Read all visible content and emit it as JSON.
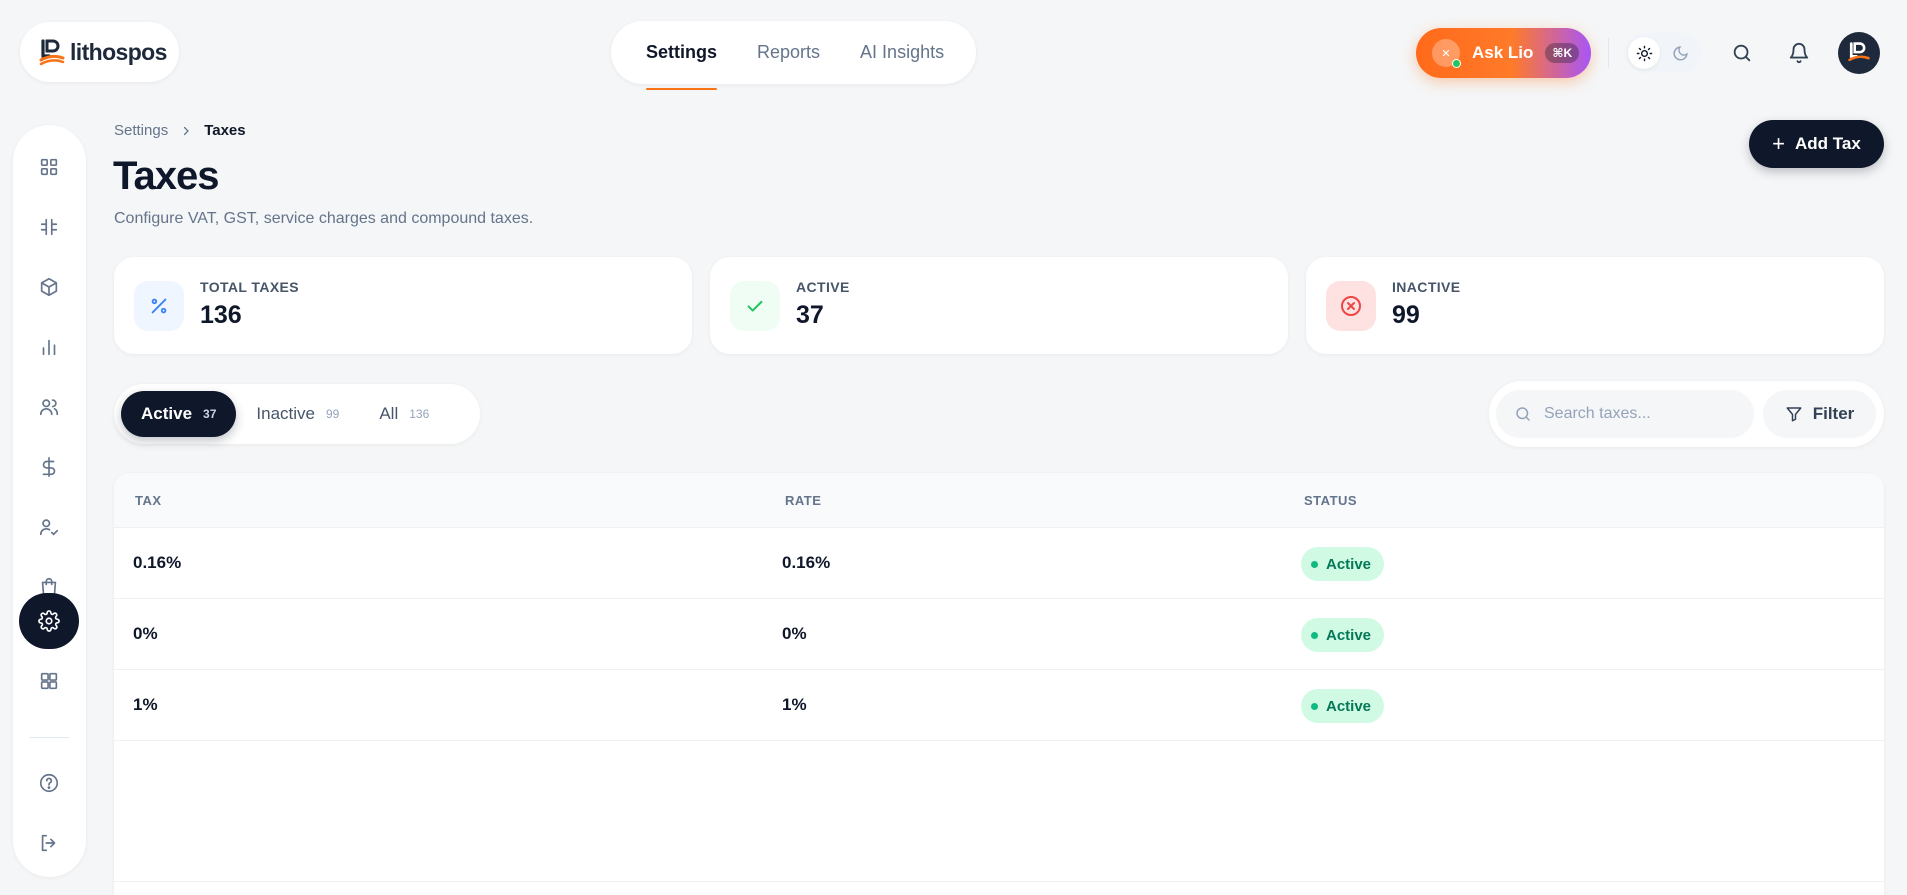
{
  "brand": {
    "name": "lithospos"
  },
  "topnav": {
    "tabs": [
      "Settings",
      "Reports",
      "AI Insights"
    ],
    "active": "Settings"
  },
  "assistant": {
    "label": "Ask Lio",
    "shortcut": "⌘K",
    "avatar": "✕"
  },
  "breadcrumb": {
    "parent": "Settings",
    "current": "Taxes"
  },
  "page": {
    "title": "Taxes",
    "subtitle": "Configure VAT, GST, service charges and compound taxes.",
    "add_label": "Add Tax"
  },
  "stats": [
    {
      "label": "TOTAL TAXES",
      "value": "136",
      "icon": "percent-icon",
      "color": "#3b82f6"
    },
    {
      "label": "ACTIVE",
      "value": "37",
      "icon": "check-icon",
      "color": "#22c55e"
    },
    {
      "label": "INACTIVE",
      "value": "99",
      "icon": "x-circle-icon",
      "color": "#ef4444"
    }
  ],
  "segments": [
    {
      "label": "Active",
      "count": "37"
    },
    {
      "label": "Inactive",
      "count": "99"
    },
    {
      "label": "All",
      "count": "136"
    }
  ],
  "search": {
    "placeholder": "Search taxes..."
  },
  "filter": {
    "label": "Filter"
  },
  "table": {
    "columns": [
      "TAX",
      "RATE",
      "STATUS"
    ],
    "rows": [
      {
        "tax": "0.16%",
        "rate": "0.16%",
        "status": "Active"
      },
      {
        "tax": "0%",
        "rate": "0%",
        "status": "Active"
      },
      {
        "tax": "1%",
        "rate": "1%",
        "status": "Active"
      }
    ]
  },
  "colors": {
    "accent": "#f97316",
    "dark": "#0f172a",
    "success": "#047857"
  }
}
